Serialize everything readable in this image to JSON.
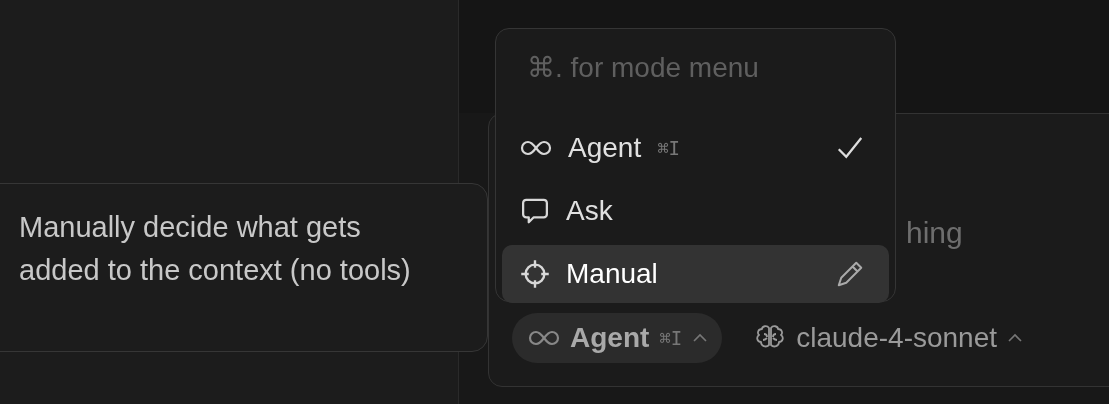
{
  "tooltip": {
    "text": "Manually decide what gets added to the context (no tools)"
  },
  "mode_menu": {
    "hint": "⌘. for mode menu",
    "items": [
      {
        "label": "Agent",
        "shortcut": "⌘I",
        "checked": true,
        "selected": false
      },
      {
        "label": "Ask",
        "checked": false,
        "selected": false
      },
      {
        "label": "Manual",
        "checked": false,
        "selected": true
      }
    ]
  },
  "composer": {
    "placeholder": "hing",
    "mode_button": {
      "label": "Agent",
      "shortcut": "⌘I"
    },
    "model_button": {
      "label": "claude-4-sonnet"
    }
  }
}
